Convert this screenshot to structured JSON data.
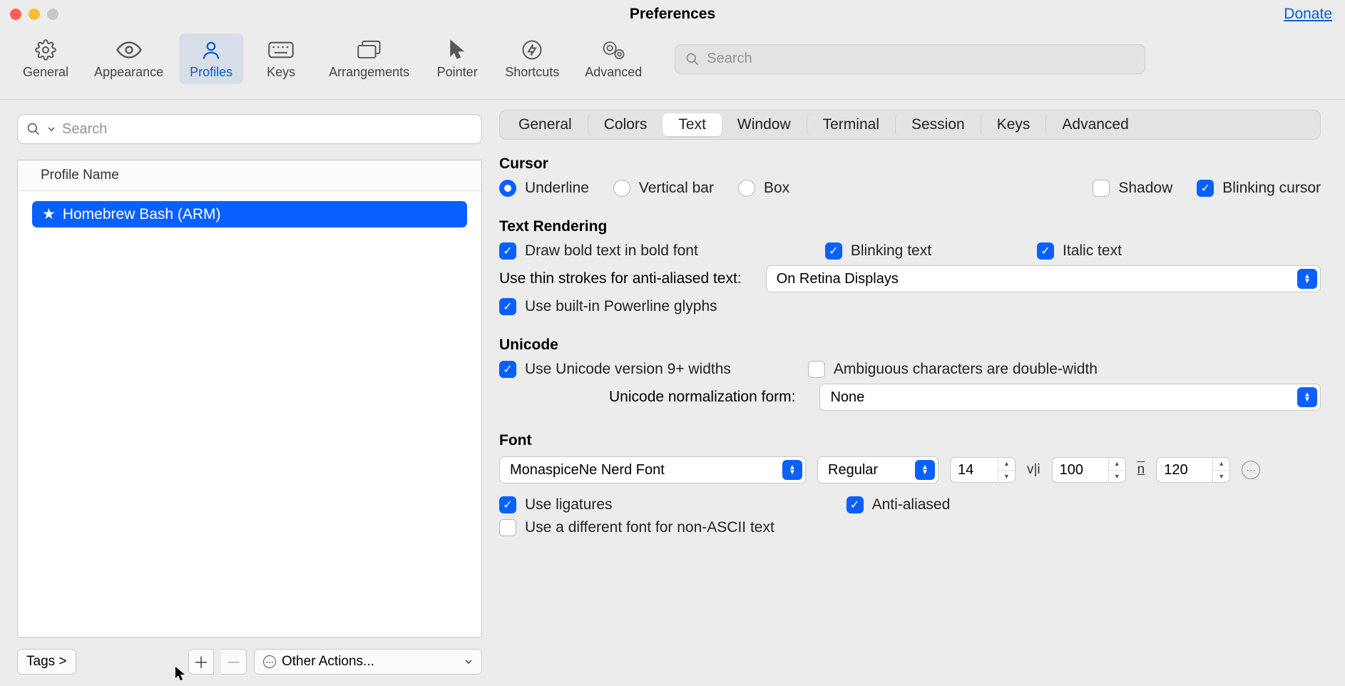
{
  "window": {
    "title": "Preferences",
    "donate": "Donate"
  },
  "toolbar": {
    "items": [
      "General",
      "Appearance",
      "Profiles",
      "Keys",
      "Arrangements",
      "Pointer",
      "Shortcuts",
      "Advanced"
    ],
    "search_placeholder": "Search"
  },
  "sidebar": {
    "search_placeholder": "Search",
    "header": "Profile Name",
    "profile": "Homebrew Bash (ARM)",
    "tags_btn": "Tags >",
    "other_actions": "Other Actions..."
  },
  "subtabs": [
    "General",
    "Colors",
    "Text",
    "Window",
    "Terminal",
    "Session",
    "Keys",
    "Advanced"
  ],
  "cursor": {
    "title": "Cursor",
    "underline": "Underline",
    "vertical": "Vertical bar",
    "box": "Box",
    "shadow": "Shadow",
    "blinking": "Blinking cursor"
  },
  "text_rendering": {
    "title": "Text Rendering",
    "bold": "Draw bold text in bold font",
    "blinking": "Blinking text",
    "italic": "Italic text",
    "thin_label": "Use thin strokes for anti-aliased text:",
    "thin_value": "On Retina Displays",
    "powerline": "Use built-in Powerline glyphs"
  },
  "unicode": {
    "title": "Unicode",
    "v9": "Use Unicode version 9+ widths",
    "ambiguous": "Ambiguous characters are double-width",
    "norm_label": "Unicode normalization form:",
    "norm_value": "None"
  },
  "font": {
    "title": "Font",
    "family": "MonaspiceNe Nerd Font",
    "style": "Regular",
    "size": "14",
    "hspacing": "100",
    "vspacing": "120",
    "ligatures": "Use ligatures",
    "antialiased": "Anti-aliased",
    "nonascii": "Use a different font for non-ASCII text"
  }
}
